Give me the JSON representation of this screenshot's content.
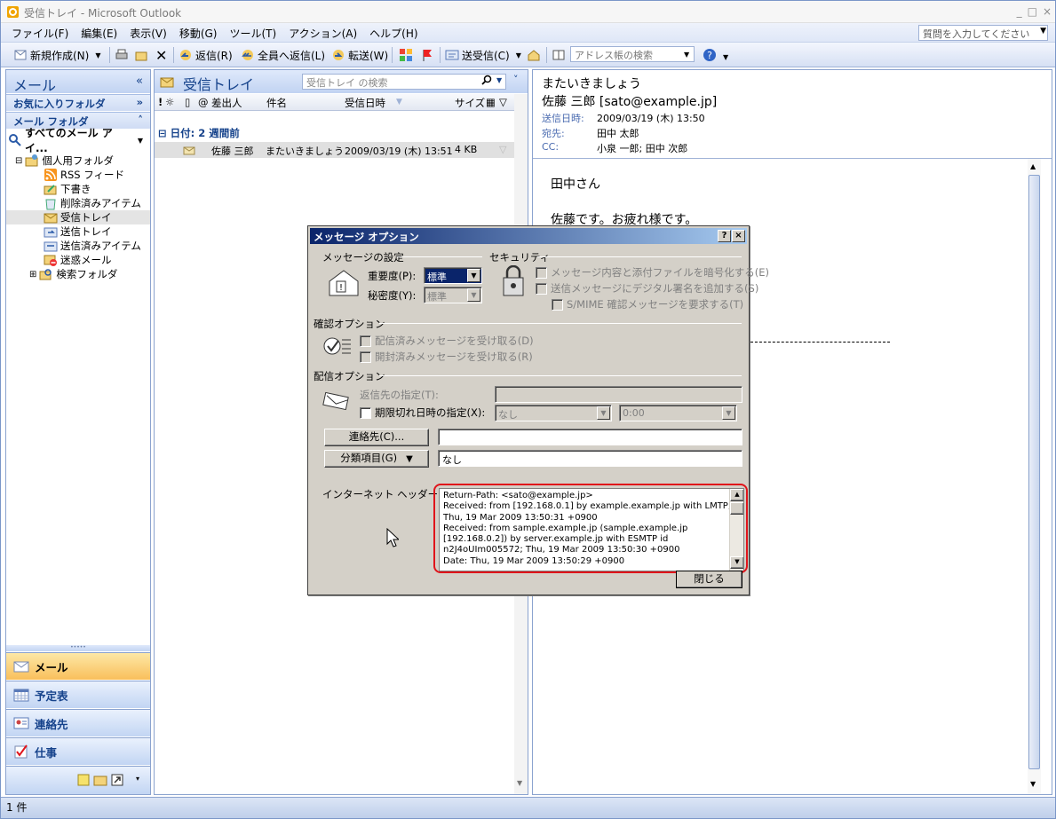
{
  "window": {
    "title": "受信トレイ - Microsoft Outlook",
    "min": "_",
    "max": "□",
    "close": "×"
  },
  "menu": {
    "items": [
      "ファイル(F)",
      "編集(E)",
      "表示(V)",
      "移動(G)",
      "ツール(T)",
      "アクション(A)",
      "ヘルプ(H)"
    ],
    "help_placeholder": "質問を入力してください"
  },
  "toolbar": {
    "new": "新規作成(N)",
    "reply": "返信(R)",
    "reply_all": "全員へ返信(L)",
    "forward": "転送(W)",
    "send_receive": "送受信(C)",
    "address_search": "アドレス帳の検索"
  },
  "nav": {
    "title": "メール",
    "favorites": "お気に入りフォルダ",
    "mail_folders": "メール フォルダ",
    "all_items": "すべてのメール アイ...",
    "folders": [
      {
        "label": "個人用フォルダ"
      },
      {
        "label": "RSS フィード"
      },
      {
        "label": "下書き"
      },
      {
        "label": "削除済みアイテム"
      },
      {
        "label": "受信トレイ"
      },
      {
        "label": "送信トレイ"
      },
      {
        "label": "送信済みアイテム"
      },
      {
        "label": "迷惑メール"
      },
      {
        "label": "検索フォルダ"
      }
    ],
    "buttons": [
      "メール",
      "予定表",
      "連絡先",
      "仕事"
    ]
  },
  "list": {
    "title": "受信トレイ",
    "search_placeholder": "受信トレイ の検索",
    "columns": {
      "from": "差出人",
      "subject": "件名",
      "received": "受信日時",
      "size": "サイズ"
    },
    "group": "日付: 2 週間前",
    "messages": [
      {
        "from": "佐藤 三郎",
        "subject": "またいきましょう",
        "received": "2009/03/19 (木) 13:51",
        "size": "4 KB"
      }
    ]
  },
  "reading": {
    "subject": "またいきましょう",
    "from": "佐藤 三郎 [sato@example.jp]",
    "sent_label": "送信日時:",
    "sent_value": "2009/03/19 (木) 13:50",
    "to_label": "宛先:",
    "to_value": "田中 太郎",
    "cc_label": "CC:",
    "cc_value": "小泉 一郎; 田中 次郎",
    "body": [
      "田中さん",
      "佐藤です。お疲れ様です。"
    ]
  },
  "status": {
    "count": "1 件"
  },
  "dialog": {
    "title": "メッセージ オプション",
    "help_btn": "?",
    "close_x": "×",
    "msg_settings": "メッセージの設定",
    "importance_label": "重要度(P):",
    "importance_value": "標準",
    "sensitivity_label": "秘密度(Y):",
    "sensitivity_value": "標準",
    "security": "セキュリティ",
    "encrypt": "メッセージ内容と添付ファイルを暗号化する(E)",
    "sign": "送信メッセージにデジタル署名を追加する(S)",
    "smime": "S/MIME 確認メッセージを要求する(T)",
    "tracking": "確認オプション",
    "read_receipt_delivered": "配信済みメッセージを受け取る(D)",
    "read_receipt_opened": "開封済みメッセージを受け取る(R)",
    "delivery": "配信オプション",
    "reply_to": "返信先の指定(T):",
    "expire": "期限切れ日時の指定(X):",
    "expire_date": "なし",
    "expire_time": "0:00",
    "contacts_btn": "連絡先(C)...",
    "categories_btn": "分類項目(G)",
    "categories_value": "なし",
    "headers_label": "インターネット ヘッダー(H):",
    "headers": [
      "Return-Path: <sato@example.jp>",
      "Received: from [192.168.0.1] by example.example.jp with LMTP;",
      "Thu, 19 Mar 2009 13:50:31 +0900",
      "Received: from sample.example.jp (sample.example.jp",
      "[192.168.0.2]) by server.example.jp with ESMTP id",
      "n2J4oUIm005572; Thu, 19 Mar 2009 13:50:30 +0900",
      "Date: Thu, 19 Mar 2009 13:50:29 +0900"
    ],
    "close_btn": "閉じる"
  }
}
